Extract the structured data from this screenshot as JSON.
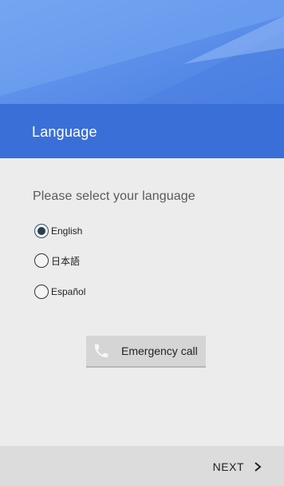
{
  "header": {
    "title": "Language"
  },
  "content": {
    "prompt": "Please select your language",
    "languages": [
      {
        "label": "English",
        "selected": true
      },
      {
        "label": "日本語",
        "selected": false
      },
      {
        "label": "Español",
        "selected": false
      }
    ]
  },
  "emergency": {
    "label": "Emergency call",
    "icon": "phone-icon"
  },
  "footer": {
    "next_label": "NEXT",
    "next_icon": "chevron-right-icon"
  },
  "colors": {
    "header_accent": "#3b6fd8",
    "hero_top": "#6fa1f1",
    "background": "#ececec",
    "footer": "#dcdcdc"
  }
}
